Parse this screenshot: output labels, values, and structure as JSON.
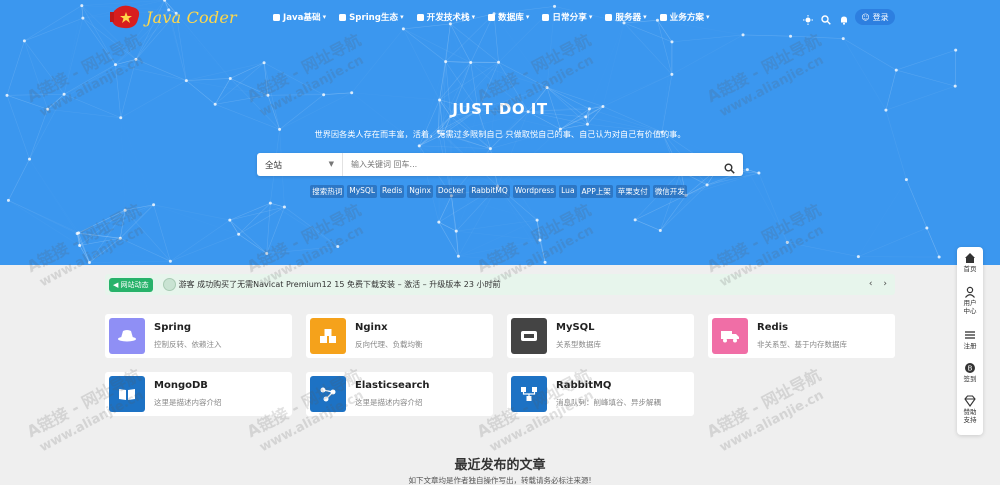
{
  "header": {
    "logo_text": "Java Coder",
    "nav": [
      {
        "label": "Java基础",
        "icon": "java-cup-icon"
      },
      {
        "label": "Spring生态",
        "icon": "spring-leaf-icon"
      },
      {
        "label": "开发技术栈",
        "icon": "code-icon"
      },
      {
        "label": "数据库",
        "icon": "database-icon"
      },
      {
        "label": "日常分享",
        "icon": "calendar-icon"
      },
      {
        "label": "服务器",
        "icon": "server-icon"
      },
      {
        "label": "业务方案",
        "icon": "tools-icon"
      }
    ],
    "login_label": "登录"
  },
  "hero": {
    "title": "JUST DO IT",
    "subtitle": "世界因各类人存在而丰富，活着，无需过多限制自己 只做取悦自己的事、自己认为对自己有价值的事。",
    "search_category": "全站",
    "search_placeholder": "输入关键词 回车...",
    "hot_tags": [
      "搜索热词",
      "MySQL",
      "Redis",
      "Nginx",
      "Docker",
      "RabbitMQ",
      "Wordpress",
      "Lua",
      "APP上架",
      "苹果支付",
      "微信开发"
    ]
  },
  "ticker": {
    "badge": "网站动态",
    "text": "游客  成功购买了无需Navicat Premium12 15 免费下载安装 – 激活 – 升级版本  23 小时前",
    "prev": "‹",
    "next": "›"
  },
  "cards": [
    {
      "title": "Spring",
      "desc": "控制反转、依赖注入",
      "color": "#8f8ff5",
      "icon": "hat-icon"
    },
    {
      "title": "Nginx",
      "desc": "反向代理、负载均衡",
      "color": "#f5a21b",
      "icon": "boxes-icon"
    },
    {
      "title": "MySQL",
      "desc": "关系型数据库",
      "color": "#444444",
      "icon": "mysql-icon"
    },
    {
      "title": "Redis",
      "desc": "非关系型、基于内存数据库",
      "color": "#f06ea6",
      "icon": "truck-icon"
    },
    {
      "title": "MongoDB",
      "desc": "这里是描述内容介绍",
      "color": "#1d72c4",
      "icon": "book-icon"
    },
    {
      "title": "Elasticsearch",
      "desc": "这里是描述内容介绍",
      "color": "#1d72c4",
      "icon": "graph-icon"
    },
    {
      "title": "RabbitMQ",
      "desc": "消息队列：削峰填谷、异步解耦",
      "color": "#1d72c4",
      "icon": "network-icon"
    }
  ],
  "recent": {
    "title": "最近发布的文章",
    "subtitle": "如下文章均是作者独自操作写出，转载请务必标注来源!"
  },
  "sidebar": [
    {
      "label": "首页",
      "icon": "home-icon"
    },
    {
      "label": "用户中心",
      "icon": "user-icon"
    },
    {
      "label": "注册",
      "icon": "menu-icon"
    },
    {
      "label": "签到",
      "icon": "coin-icon"
    },
    {
      "label": "赞助支持",
      "icon": "diamond-icon"
    }
  ],
  "watermark": "A链接 - 网址导航",
  "watermark_url": "www.alianjie.cn"
}
